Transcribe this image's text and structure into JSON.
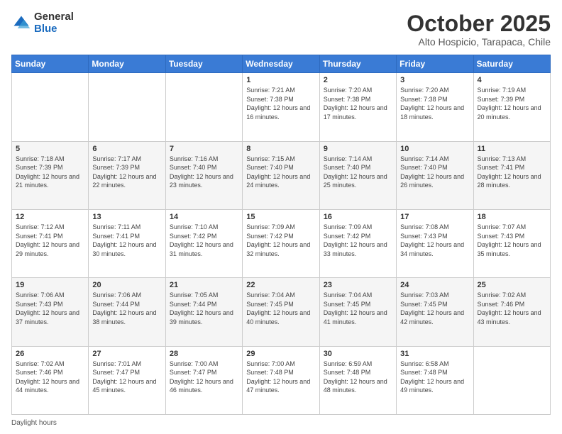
{
  "header": {
    "logo_general": "General",
    "logo_blue": "Blue",
    "month_title": "October 2025",
    "subtitle": "Alto Hospicio, Tarapaca, Chile"
  },
  "days_of_week": [
    "Sunday",
    "Monday",
    "Tuesday",
    "Wednesday",
    "Thursday",
    "Friday",
    "Saturday"
  ],
  "weeks": [
    [
      {
        "day": "",
        "info": ""
      },
      {
        "day": "",
        "info": ""
      },
      {
        "day": "",
        "info": ""
      },
      {
        "day": "1",
        "info": "Sunrise: 7:21 AM\nSunset: 7:38 PM\nDaylight: 12 hours and 16 minutes."
      },
      {
        "day": "2",
        "info": "Sunrise: 7:20 AM\nSunset: 7:38 PM\nDaylight: 12 hours and 17 minutes."
      },
      {
        "day": "3",
        "info": "Sunrise: 7:20 AM\nSunset: 7:38 PM\nDaylight: 12 hours and 18 minutes."
      },
      {
        "day": "4",
        "info": "Sunrise: 7:19 AM\nSunset: 7:39 PM\nDaylight: 12 hours and 20 minutes."
      }
    ],
    [
      {
        "day": "5",
        "info": "Sunrise: 7:18 AM\nSunset: 7:39 PM\nDaylight: 12 hours and 21 minutes."
      },
      {
        "day": "6",
        "info": "Sunrise: 7:17 AM\nSunset: 7:39 PM\nDaylight: 12 hours and 22 minutes."
      },
      {
        "day": "7",
        "info": "Sunrise: 7:16 AM\nSunset: 7:40 PM\nDaylight: 12 hours and 23 minutes."
      },
      {
        "day": "8",
        "info": "Sunrise: 7:15 AM\nSunset: 7:40 PM\nDaylight: 12 hours and 24 minutes."
      },
      {
        "day": "9",
        "info": "Sunrise: 7:14 AM\nSunset: 7:40 PM\nDaylight: 12 hours and 25 minutes."
      },
      {
        "day": "10",
        "info": "Sunrise: 7:14 AM\nSunset: 7:40 PM\nDaylight: 12 hours and 26 minutes."
      },
      {
        "day": "11",
        "info": "Sunrise: 7:13 AM\nSunset: 7:41 PM\nDaylight: 12 hours and 28 minutes."
      }
    ],
    [
      {
        "day": "12",
        "info": "Sunrise: 7:12 AM\nSunset: 7:41 PM\nDaylight: 12 hours and 29 minutes."
      },
      {
        "day": "13",
        "info": "Sunrise: 7:11 AM\nSunset: 7:41 PM\nDaylight: 12 hours and 30 minutes."
      },
      {
        "day": "14",
        "info": "Sunrise: 7:10 AM\nSunset: 7:42 PM\nDaylight: 12 hours and 31 minutes."
      },
      {
        "day": "15",
        "info": "Sunrise: 7:09 AM\nSunset: 7:42 PM\nDaylight: 12 hours and 32 minutes."
      },
      {
        "day": "16",
        "info": "Sunrise: 7:09 AM\nSunset: 7:42 PM\nDaylight: 12 hours and 33 minutes."
      },
      {
        "day": "17",
        "info": "Sunrise: 7:08 AM\nSunset: 7:43 PM\nDaylight: 12 hours and 34 minutes."
      },
      {
        "day": "18",
        "info": "Sunrise: 7:07 AM\nSunset: 7:43 PM\nDaylight: 12 hours and 35 minutes."
      }
    ],
    [
      {
        "day": "19",
        "info": "Sunrise: 7:06 AM\nSunset: 7:43 PM\nDaylight: 12 hours and 37 minutes."
      },
      {
        "day": "20",
        "info": "Sunrise: 7:06 AM\nSunset: 7:44 PM\nDaylight: 12 hours and 38 minutes."
      },
      {
        "day": "21",
        "info": "Sunrise: 7:05 AM\nSunset: 7:44 PM\nDaylight: 12 hours and 39 minutes."
      },
      {
        "day": "22",
        "info": "Sunrise: 7:04 AM\nSunset: 7:45 PM\nDaylight: 12 hours and 40 minutes."
      },
      {
        "day": "23",
        "info": "Sunrise: 7:04 AM\nSunset: 7:45 PM\nDaylight: 12 hours and 41 minutes."
      },
      {
        "day": "24",
        "info": "Sunrise: 7:03 AM\nSunset: 7:45 PM\nDaylight: 12 hours and 42 minutes."
      },
      {
        "day": "25",
        "info": "Sunrise: 7:02 AM\nSunset: 7:46 PM\nDaylight: 12 hours and 43 minutes."
      }
    ],
    [
      {
        "day": "26",
        "info": "Sunrise: 7:02 AM\nSunset: 7:46 PM\nDaylight: 12 hours and 44 minutes."
      },
      {
        "day": "27",
        "info": "Sunrise: 7:01 AM\nSunset: 7:47 PM\nDaylight: 12 hours and 45 minutes."
      },
      {
        "day": "28",
        "info": "Sunrise: 7:00 AM\nSunset: 7:47 PM\nDaylight: 12 hours and 46 minutes."
      },
      {
        "day": "29",
        "info": "Sunrise: 7:00 AM\nSunset: 7:48 PM\nDaylight: 12 hours and 47 minutes."
      },
      {
        "day": "30",
        "info": "Sunrise: 6:59 AM\nSunset: 7:48 PM\nDaylight: 12 hours and 48 minutes."
      },
      {
        "day": "31",
        "info": "Sunrise: 6:58 AM\nSunset: 7:48 PM\nDaylight: 12 hours and 49 minutes."
      },
      {
        "day": "",
        "info": ""
      }
    ]
  ],
  "footer": {
    "daylight_label": "Daylight hours"
  }
}
